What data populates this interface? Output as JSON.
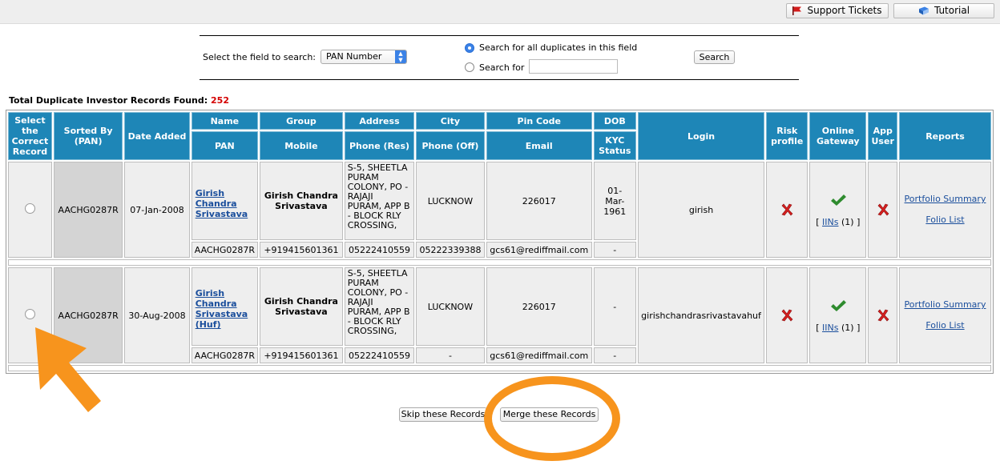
{
  "topbar": {
    "support_label": "Support Tickets",
    "tutorial_label": "Tutorial"
  },
  "search": {
    "field_label": "Select the field to search:",
    "field_value": "PAN Number",
    "option_all_label": "Search for all duplicates in this field",
    "option_for_label": "Search for",
    "input_value": "",
    "button_label": "Search"
  },
  "summary": {
    "label": "Total Duplicate Investor Records Found:",
    "count": "252"
  },
  "table": {
    "headers": {
      "select": "Select the Correct Record",
      "sorted": "Sorted By (PAN)",
      "date_added": "Date Added",
      "name": "Name",
      "group": "Group",
      "address": "Address",
      "city": "City",
      "pincode": "Pin Code",
      "dob": "DOB",
      "login": "Login",
      "risk": "Risk profile",
      "online": "Online Gateway",
      "app_user": "App User",
      "reports": "Reports",
      "pan": "PAN",
      "mobile": "Mobile",
      "phone_res": "Phone (Res)",
      "phone_off": "Phone (Off)",
      "email": "Email",
      "kyc": "KYC Status"
    },
    "records": [
      {
        "sorted": "AACHG0287R",
        "date_added": "07-Jan-2008",
        "name_lines": [
          "Girish",
          "Chandra",
          "Srivastava"
        ],
        "group": "Girish Chandra Srivastava",
        "address_lines": [
          "S-5, SHEETLA",
          "PURAM",
          "COLONY, PO -",
          "RAJAJI",
          "PURAM, APP B",
          "- BLOCK RLY",
          "CROSSING,"
        ],
        "city": "LUCKNOW",
        "pincode": "226017",
        "dob_lines": [
          "01-",
          "Mar-",
          "1961"
        ],
        "login": "girish",
        "iins_prefix": "[",
        "iins_link": "IINs",
        "iins_suffix": "(1) ]",
        "report_1": "Portfolio Summary",
        "report_2": "Folio List",
        "pan": "AACHG0287R",
        "mobile": "+919415601361",
        "phone_res": "05222410559",
        "phone_off": "05222339388",
        "email": "gcs61@rediffmail.com",
        "kyc": "-"
      },
      {
        "sorted": "AACHG0287R",
        "date_added": "30-Aug-2008",
        "name_lines": [
          "Girish",
          "Chandra",
          "Srivastava",
          "(Huf)"
        ],
        "group": "Girish Chandra Srivastava",
        "address_lines": [
          "S-5, SHEETLA",
          "PURAM",
          "COLONY, PO -",
          "RAJAJI",
          "PURAM, APP B",
          "- BLOCK RLY",
          "CROSSING,"
        ],
        "city": "LUCKNOW",
        "pincode": "226017",
        "dob_lines": [
          "-"
        ],
        "login": "girishchandrasrivastavahuf",
        "iins_prefix": "[",
        "iins_link": "IINs",
        "iins_suffix": "(1) ]",
        "report_1": "Portfolio Summary",
        "report_2": "Folio List",
        "pan": "AACHG0287R",
        "mobile": "+919415601361",
        "phone_res": "05222410559",
        "phone_off": "-",
        "email": "gcs61@rediffmail.com",
        "kyc": "-"
      }
    ]
  },
  "actions": {
    "skip_label": "Skip these Records",
    "merge_label": "Merge these Records"
  },
  "colors": {
    "header_blue": "#1e86b7",
    "annotation_orange": "#f7941d",
    "count_red": "#d40000"
  },
  "icons": [
    "flag-icon",
    "book-icon",
    "x-icon",
    "check-icon",
    "arrow-annotation",
    "ellipse-annotation"
  ]
}
